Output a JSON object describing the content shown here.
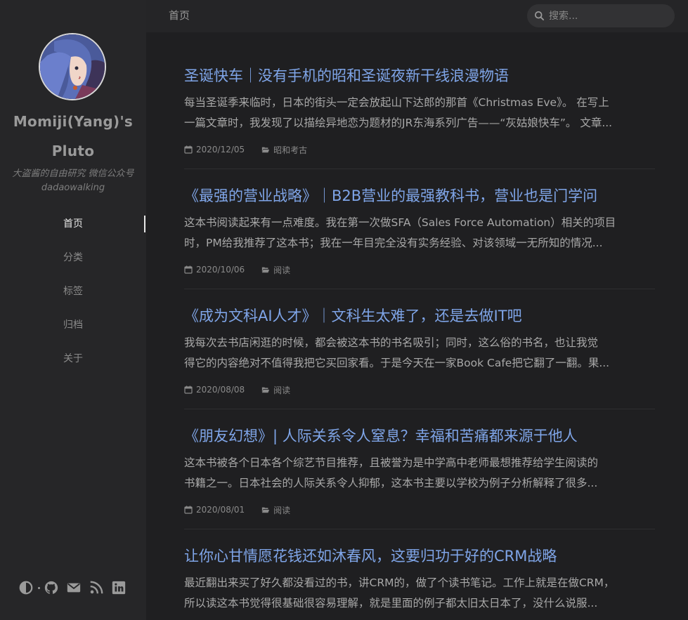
{
  "sidebar": {
    "site_title": "Momiji(Yang)'s Pluto",
    "site_description": "大盗酱的自由研究 微信公众号 dadaowalking",
    "nav": [
      {
        "label": "首页",
        "active": true
      },
      {
        "label": "分类"
      },
      {
        "label": "标签"
      },
      {
        "label": "归档"
      },
      {
        "label": "关于"
      }
    ],
    "social_icons": [
      "theme-toggle-icon",
      "github-icon",
      "email-icon",
      "rss-icon",
      "linkedin-icon"
    ]
  },
  "header": {
    "breadcrumb": "首页",
    "search_placeholder": "搜索..."
  },
  "posts": [
    {
      "title": "圣诞快车｜没有手机的昭和圣诞夜新干线浪漫物语",
      "excerpt_line1": "每当圣诞季来临时，日本的街头一定会放起山下达郎的那首《Christmas Eve》。 在写上",
      "excerpt_line2": "一篇文章时，我发现了以描绘异地恋为题材的JR东海系列广告——“灰姑娘快车”。 文章...",
      "date": "2020/12/05",
      "category": "昭和考古"
    },
    {
      "title": "《最强的营业战略》｜B2B营业的最强教科书，营业也是门学问",
      "excerpt_line1": "这本书阅读起来有一点难度。我在第一次做SFA（Sales Force Automation）相关的项目",
      "excerpt_line2": "时，PM给我推荐了这本书；我在一年目完全没有实务经验、对该领域一无所知的情况...",
      "date": "2020/10/06",
      "category": "阅读"
    },
    {
      "title": "《成为文科AI人才》｜文科生太难了，还是去做IT吧",
      "excerpt_line1": "我每次去书店闲逛的时候，都会被这本书的书名吸引；同时，这么俗的书名，也让我觉",
      "excerpt_line2": "得它的内容绝对不值得我把它买回家看。于是今天在一家Book Cafe把它翻了一翻。果...",
      "date": "2020/08/08",
      "category": "阅读"
    },
    {
      "title": "《朋友幻想》| 人际关系令人窒息？幸福和苦痛都来源于他人",
      "excerpt_line1": "这本书被各个日本各个综艺节目推荐，且被誉为是中学高中老师最想推荐给学生阅读的",
      "excerpt_line2": "书籍之一。日本社会的人际关系令人抑郁，这本书主要以学校为例子分析解释了很多...",
      "date": "2020/08/01",
      "category": "阅读"
    },
    {
      "title": "让你心甘情愿花钱还如沐春风，这要归功于好的CRM战略",
      "excerpt_line1": "最近翻出来买了好久都没看过的书，讲CRM的，做了个读书笔记。工作上就是在做CRM，",
      "excerpt_line2": "所以读这本书觉得很基础很容易理解，就是里面的例子都太旧太日本了，没什么说服...",
      "date": "",
      "category": ""
    }
  ],
  "colors": {
    "background": "#1f1f21",
    "sidebar": "#262628",
    "link": "#7fa5e8"
  }
}
